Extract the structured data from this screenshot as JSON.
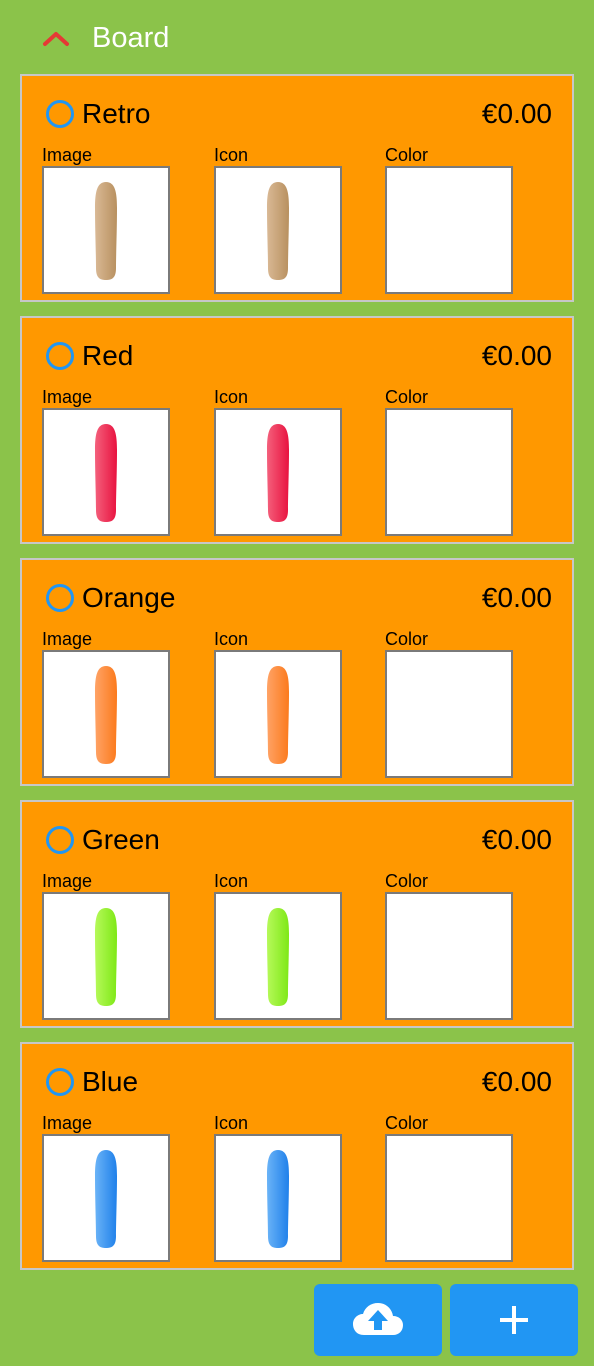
{
  "header": {
    "title": "Board",
    "collapse_icon": "chevron-up-icon",
    "collapse_color": "#e53935"
  },
  "labels": {
    "image": "Image",
    "icon": "Icon",
    "color": "Color"
  },
  "options": [
    {
      "name": "Retro",
      "price": "€0.00",
      "board_color": "#d9b995",
      "board_shade": "#b8905f"
    },
    {
      "name": "Red",
      "price": "€0.00",
      "board_color": "#f4607c",
      "board_shade": "#e8123f"
    },
    {
      "name": "Orange",
      "price": "€0.00",
      "board_color": "#ffa366",
      "board_shade": "#fb7a1c"
    },
    {
      "name": "Green",
      "price": "€0.00",
      "board_color": "#b6f95a",
      "board_shade": "#7ee816"
    },
    {
      "name": "Blue",
      "price": "€0.00",
      "board_color": "#6ab3f7",
      "board_shade": "#1f80ea"
    }
  ],
  "actions": {
    "upload_icon": "cloud-upload-icon",
    "add_icon": "plus-icon"
  },
  "colors": {
    "background": "#8bc34a",
    "card": "#ff9800",
    "accent": "#2196f3"
  }
}
